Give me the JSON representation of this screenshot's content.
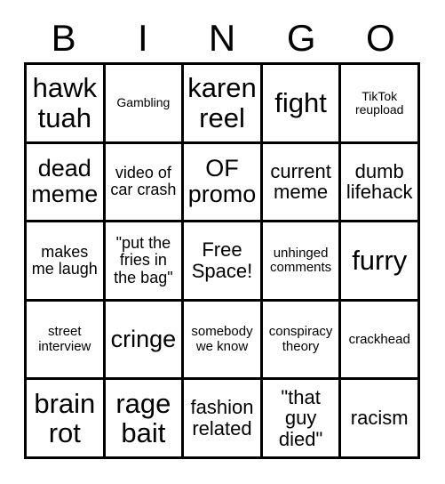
{
  "card": {
    "type": "bingo-card",
    "header_letters": [
      "B",
      "I",
      "N",
      "G",
      "O"
    ],
    "grid_size": 5,
    "colors": {
      "background": "#ffffff",
      "text": "#000000",
      "border": "#000000"
    },
    "rows": [
      [
        {
          "label": "hawk tuah",
          "size": "xl"
        },
        {
          "label": "Gambling",
          "size": "xxs"
        },
        {
          "label": "karen reel",
          "size": "xl"
        },
        {
          "label": "fight",
          "size": "xl"
        },
        {
          "label": "TikTok reupload",
          "size": "xxs"
        }
      ],
      [
        {
          "label": "dead meme",
          "size": "lg"
        },
        {
          "label": "video of car crash",
          "size": "sm"
        },
        {
          "label": "OF promo",
          "size": "lg"
        },
        {
          "label": "current meme",
          "size": "md"
        },
        {
          "label": "dumb lifehack",
          "size": "md"
        }
      ],
      [
        {
          "label": "makes me laugh",
          "size": "sm"
        },
        {
          "label": "\"put the fries in the bag\"",
          "size": "sm"
        },
        {
          "label": "Free Space!",
          "size": "md"
        },
        {
          "label": "unhinged comments",
          "size": "xs"
        },
        {
          "label": "furry",
          "size": "xl"
        }
      ],
      [
        {
          "label": "street interview",
          "size": "xs"
        },
        {
          "label": "cringe",
          "size": "lg"
        },
        {
          "label": "somebody we know",
          "size": "xs"
        },
        {
          "label": "conspiracy theory",
          "size": "xs"
        },
        {
          "label": "crackhead",
          "size": "xs"
        }
      ],
      [
        {
          "label": "brain rot",
          "size": "xl"
        },
        {
          "label": "rage bait",
          "size": "xl"
        },
        {
          "label": "fashion related",
          "size": "md"
        },
        {
          "label": "\"that guy died\"",
          "size": "md"
        },
        {
          "label": "racism",
          "size": "md"
        }
      ]
    ]
  }
}
